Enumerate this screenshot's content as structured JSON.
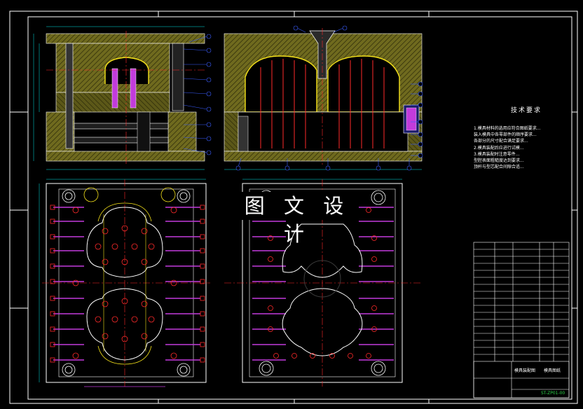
{
  "watermark": "图 文 设 计",
  "technical_requirements": {
    "title": "技术要求",
    "lines": [
      "1.模具材料的选用应符合图纸要求...",
      "装入模具中各零部件的顺序要求...",
      "各部分的尺寸配合满足要求...",
      "2.模具装配后应进行试模...",
      "3.模具装配时注意零件...",
      "型腔表面粗糙度达到要求...",
      "顶杆与型芯配合间隙合适..."
    ]
  },
  "title_block": {
    "label_1": "模具装配图",
    "label_2": "模具图纸",
    "label_3": "ST-ZP01-00"
  },
  "colors": {
    "background": "#000000",
    "frame": "#ffffff",
    "plate_fill": "#6f6a1e",
    "cyan": "#00e5e5",
    "blue": "#3a5dff",
    "red": "#ff2a2a",
    "yellow": "#f4e11a",
    "magenta": "#c23bdc",
    "green": "#2fd34a"
  }
}
